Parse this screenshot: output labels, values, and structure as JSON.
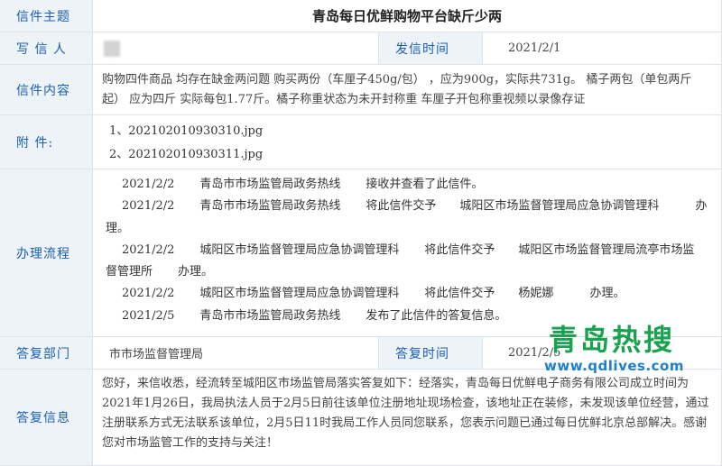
{
  "subject": {
    "label": "信件主题",
    "title": "青岛每日优鲜购物平台缺斤少两"
  },
  "writer": {
    "label": "写 信 人",
    "sent_time_label": "发信时间",
    "sent_time": "2021/2/1"
  },
  "content": {
    "label": "信件内容",
    "text": "购物四件商品 均存在缺金两问题 购买两份（车厘子450g/包） ，应为900g，实际共731g。 橘子两包（单包两斤起） 应为四斤 实际每包1.77斤。橘子称重状态为未开封称重 车厘子开包称重视频以录像存证"
  },
  "attachments": {
    "label": "附    件:",
    "files": [
      "1、202102010930310.jpg",
      "2、202102010930311.jpg"
    ]
  },
  "process": {
    "label": "办理流程",
    "rows": [
      {
        "date": "2021/2/2",
        "dept": "青岛市市场监管局政务热线",
        "action": "接收并查看了此信件。",
        "target": "",
        "tail": ""
      },
      {
        "date": "2021/2/2",
        "dept": "青岛市市场监管局政务热线",
        "action": "将此信件交予",
        "target": "城阳区市场监督管理局应急协调管理科",
        "tail": "办"
      },
      {
        "date": "2021/2/2",
        "dept": "城阳区市场监督管理局应急协调管理科",
        "action": "将此信件交予",
        "target": "城阳区市场监督管理局流亭市场监督管理所",
        "tail": "办理。"
      },
      {
        "date": "2021/2/2",
        "dept": "城阳区市场监督管理局应急协调管理科",
        "action": "将此信件交予",
        "target": "杨妮娜",
        "tail": "办理。"
      },
      {
        "date": "2021/2/5",
        "dept": "青岛市市场监管局政务热线",
        "action": "发布了此信件的答复信息。",
        "target": "",
        "tail": ""
      }
    ],
    "wrap_line1_tail": "理。"
  },
  "reply_dept": {
    "label": "答复部门",
    "value": "市市场监督管理局",
    "time_label": "答复时间",
    "time": "2021/2/5"
  },
  "reply": {
    "label": "答复信息",
    "text": "您好，来信收悉，经流转至城阳区市场监管局落实答复如下：经落实，青岛每日优鲜电子商务有限公司成立时间为2021年1月26日，我局执法人员于2月5日前往该单位注册地址现场检查，该地址正在装修，未发现该单位经营，通过注册联系方式无法联系该单位，2月5日11时我局工作人员同您联系，您表示问题已通过每日优鲜北京总部解决。感谢您对市场监管工作的支持与关注！"
  },
  "watermark": {
    "title": "青岛热搜",
    "url": "www.qdlives.com"
  },
  "colors": {
    "label_bg": "#eef3f8",
    "label_text": "#1a5fb4",
    "border": "#dde3ea",
    "watermark_green": "#19a24f",
    "watermark_blue": "#1c7fd0"
  }
}
